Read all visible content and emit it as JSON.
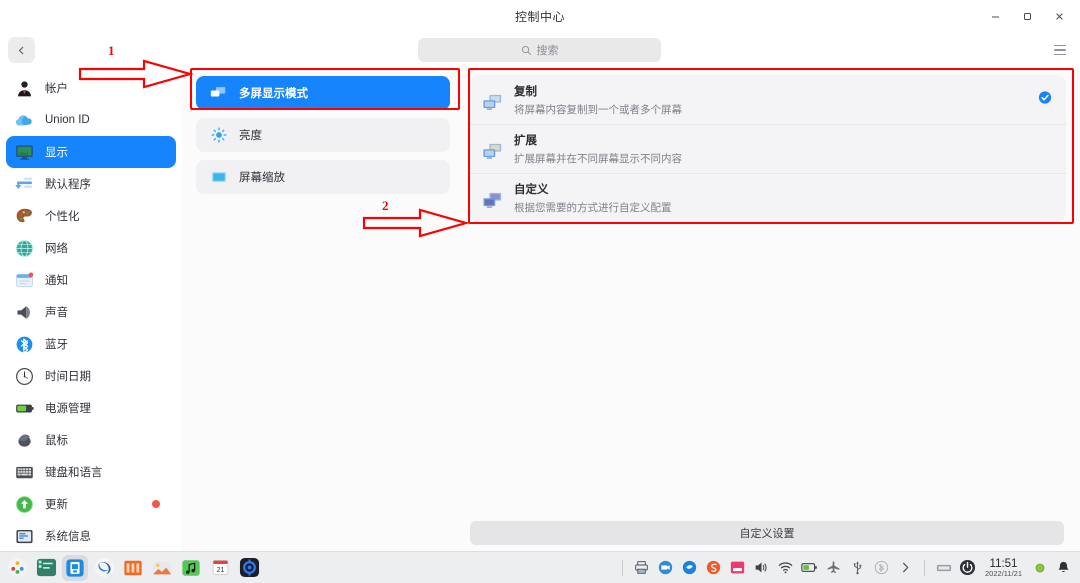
{
  "window": {
    "title": "控制中心",
    "controls": {
      "minimize": "minimize",
      "maximize": "maximize",
      "close": "close"
    }
  },
  "toolbar": {
    "back_label": "返回",
    "search_placeholder": "搜索",
    "menu_label": "菜单"
  },
  "sidebar": {
    "items": [
      {
        "label": "帐户",
        "icon": "account-icon",
        "active": false,
        "badge": false
      },
      {
        "label": "Union ID",
        "icon": "union-id-icon",
        "active": false,
        "badge": false
      },
      {
        "label": "显示",
        "icon": "display-icon",
        "active": true,
        "badge": false
      },
      {
        "label": "默认程序",
        "icon": "default-apps-icon",
        "active": false,
        "badge": false
      },
      {
        "label": "个性化",
        "icon": "personalization-icon",
        "active": false,
        "badge": false
      },
      {
        "label": "网络",
        "icon": "network-icon",
        "active": false,
        "badge": false
      },
      {
        "label": "通知",
        "icon": "notification-icon",
        "active": false,
        "badge": false
      },
      {
        "label": "声音",
        "icon": "sound-icon",
        "active": false,
        "badge": false
      },
      {
        "label": "蓝牙",
        "icon": "bluetooth-icon",
        "active": false,
        "badge": false
      },
      {
        "label": "时间日期",
        "icon": "datetime-icon",
        "active": false,
        "badge": false
      },
      {
        "label": "电源管理",
        "icon": "power-icon",
        "active": false,
        "badge": false
      },
      {
        "label": "鼠标",
        "icon": "mouse-icon",
        "active": false,
        "badge": false
      },
      {
        "label": "键盘和语言",
        "icon": "keyboard-icon",
        "active": false,
        "badge": false
      },
      {
        "label": "更新",
        "icon": "update-icon",
        "active": false,
        "badge": true
      },
      {
        "label": "系统信息",
        "icon": "system-info-icon",
        "active": false,
        "badge": false
      }
    ]
  },
  "middle_column": {
    "items": [
      {
        "label": "多屏显示模式",
        "icon": "multi-screen-icon",
        "selected": true
      },
      {
        "label": "亮度",
        "icon": "brightness-icon",
        "selected": false
      },
      {
        "label": "屏幕缩放",
        "icon": "screen-scale-icon",
        "selected": false
      }
    ]
  },
  "right_pane": {
    "modes": [
      {
        "title": "复制",
        "description": "将屏幕内容复制到一个或者多个屏幕",
        "icon": "duplicate-screens-icon",
        "checked": true
      },
      {
        "title": "扩展",
        "description": "扩展屏幕并在不同屏幕显示不同内容",
        "icon": "extend-screens-icon",
        "checked": false
      },
      {
        "title": "自定义",
        "description": "根据您需要的方式进行自定义配置",
        "icon": "custom-screens-icon",
        "checked": false
      }
    ],
    "custom_settings_button": "自定义设置"
  },
  "annotations": [
    {
      "number": "1",
      "target": "multi-screen-mode-item"
    },
    {
      "number": "2",
      "target": "display-mode-list"
    }
  ],
  "dock": {
    "apps": [
      {
        "name": "launcher-icon",
        "running": false
      },
      {
        "name": "terminal-icon",
        "running": false
      },
      {
        "name": "file-manager-icon",
        "running": true
      },
      {
        "name": "browser-icon",
        "running": false
      },
      {
        "name": "office-icon",
        "running": false
      },
      {
        "name": "image-viewer-icon",
        "running": false
      },
      {
        "name": "music-player-icon",
        "running": false
      },
      {
        "name": "calendar-icon",
        "running": false
      },
      {
        "name": "control-center-icon",
        "running": false
      }
    ],
    "tray": [
      {
        "name": "printer-icon"
      },
      {
        "name": "video-icon"
      },
      {
        "name": "shield-icon"
      },
      {
        "name": "sogou-input-icon"
      },
      {
        "name": "screen-record-icon"
      },
      {
        "name": "volume-icon"
      },
      {
        "name": "wifi-icon"
      },
      {
        "name": "battery-icon"
      },
      {
        "name": "airplane-icon"
      },
      {
        "name": "usb-icon"
      },
      {
        "name": "bluetooth-tray-icon"
      },
      {
        "name": "chevron-right-icon"
      },
      {
        "name": "keyboard-tray-icon"
      },
      {
        "name": "power-tray-icon"
      }
    ],
    "clock": {
      "time": "11:51",
      "date": "2022/11/21"
    },
    "right_end": [
      {
        "name": "green-dot-icon"
      },
      {
        "name": "bell-icon"
      }
    ]
  },
  "colors": {
    "accent": "#1684fc",
    "annotation": "#ff0000",
    "badge": "#f4554f",
    "window_bg": "#ffffff",
    "panel_bg": "#fbfbfc"
  }
}
